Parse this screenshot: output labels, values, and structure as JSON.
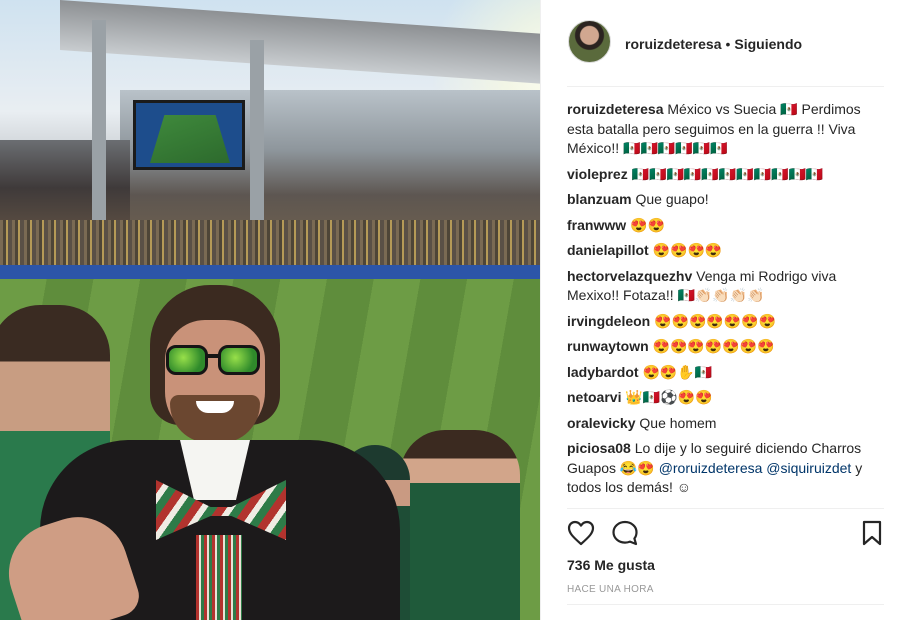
{
  "post": {
    "photo_alt": "Selfie in stadium"
  },
  "header": {
    "username": "roruizdeteresa",
    "separator": "•",
    "follow_status": "Siguiendo"
  },
  "comments": [
    {
      "user": "roruizdeteresa",
      "text": "México vs Suecia 🇲🇽 Perdimos esta batalla pero seguimos en la guerra !! Viva México!! 🇲🇽🇲🇽🇲🇽🇲🇽🇲🇽🇲🇽"
    },
    {
      "user": "violeprez",
      "text": "🇲🇽🇲🇽🇲🇽🇲🇽🇲🇽🇲🇽🇲🇽🇲🇽🇲🇽🇲🇽🇲🇽"
    },
    {
      "user": "blanzuam",
      "text": "Que guapo!"
    },
    {
      "user": "franwww",
      "text": "😍😍"
    },
    {
      "user": "danielapillot",
      "text": "😍😍😍😍"
    },
    {
      "user": "hectorvelazquezhv",
      "text": "Venga mi Rodrigo viva Mexixo!! Fotaza!! 🇲🇽👏🏻👏🏻👏🏻👏🏻"
    },
    {
      "user": "irvingdeleon",
      "text": "😍😍😍😍😍😍😍"
    },
    {
      "user": "runwaytown",
      "text": "😍😍😍😍😍😍😍"
    },
    {
      "user": "ladybardot",
      "text": "😍😍✋🇲🇽"
    },
    {
      "user": "netoarvi",
      "text": "👑🇲🇽⚽😍😍"
    },
    {
      "user": "oralevicky",
      "text": "Que homem"
    }
  ],
  "last_comment": {
    "user": "piciosa08",
    "text_before": "Lo dije y lo seguiré diciendo Charros Guapos 😂😍 ",
    "mention1": "@roruizdeteresa",
    "mention2": "@siquiruizdet",
    "text_after": " y todos los demás! ☺"
  },
  "footer": {
    "likes": "736 Me gusta",
    "time": "HACE UNA HORA"
  },
  "icons": {
    "heart": "heart-icon",
    "comment": "comment-icon",
    "bookmark": "bookmark-icon"
  }
}
